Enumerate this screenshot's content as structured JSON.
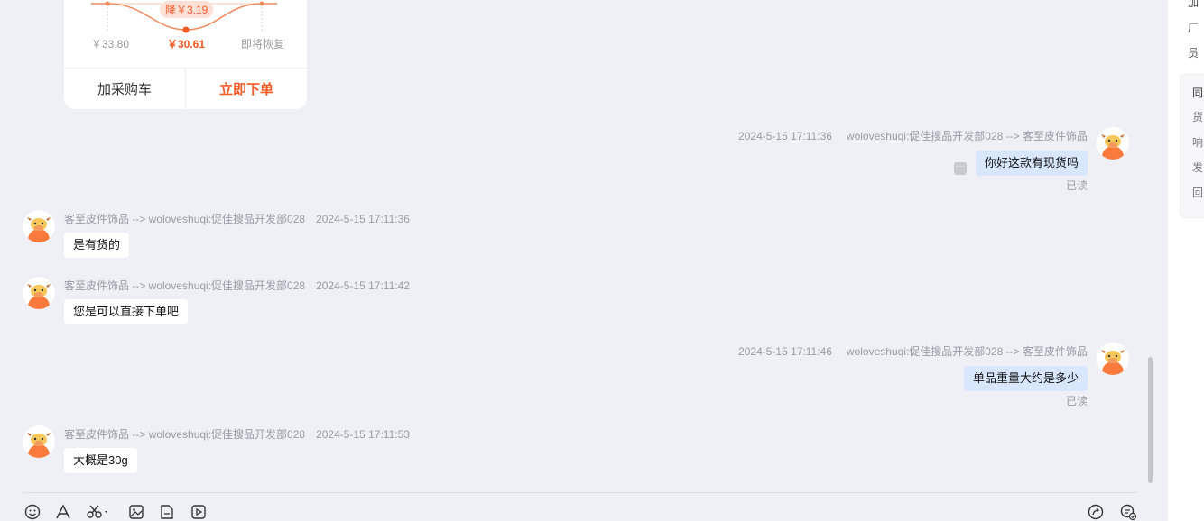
{
  "product_card": {
    "price_drop_badge": "降￥3.19",
    "price_before": "￥33.80",
    "price_now": "￥30.61",
    "price_restore": "即将恢复",
    "add_cart_label": "加采购车",
    "order_label": "立即下单"
  },
  "messages": [
    {
      "direction": "out",
      "time": "2024-5-15 17:11:36",
      "route": "woloveshuqi:促佳搜品开发部028 --> 客至皮件饰品",
      "text": "你好这款有现货吗",
      "status": "已读"
    },
    {
      "direction": "in",
      "route": "客至皮件饰品 --> woloveshuqi:促佳搜品开发部028",
      "time": "2024-5-15 17:11:36",
      "text": "是有货的"
    },
    {
      "direction": "in",
      "route": "客至皮件饰品 --> woloveshuqi:促佳搜品开发部028",
      "time": "2024-5-15 17:11:42",
      "text": "您是可以直接下单吧"
    },
    {
      "direction": "out",
      "time": "2024-5-15 17:11:46",
      "route": "woloveshuqi:促佳搜品开发部028 --> 客至皮件饰品",
      "text": "单品重量大约是多少",
      "status": "已读"
    },
    {
      "direction": "in",
      "route": "客至皮件饰品 --> woloveshuqi:促佳搜品开发部028",
      "time": "2024-5-15 17:11:53",
      "text": "大概是30g"
    }
  ],
  "toolbar": {
    "icons": [
      "emoji-icon",
      "font-icon",
      "scissors-icon",
      "image-icon",
      "file-icon",
      "video-icon",
      "share-icon",
      "quick-reply-icon"
    ]
  },
  "right_panel": {
    "lines_top": [
      "加",
      "厂",
      "员"
    ],
    "box_head": "同",
    "box_lines": [
      "货",
      "响",
      "发",
      "回"
    ]
  },
  "colors": {
    "accent": "#f05a23",
    "outgoing_bubble": "#d9e7fd",
    "background": "#eff0f5"
  }
}
